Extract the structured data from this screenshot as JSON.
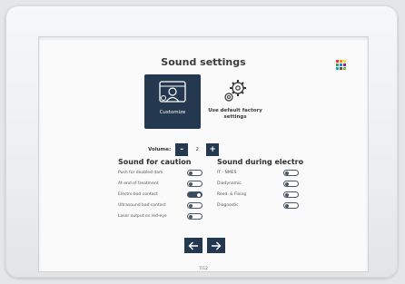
{
  "screen": {
    "title": "Sound settings"
  },
  "modes": {
    "customize_label": "Customize",
    "default_label": "Use default factory settings",
    "selected": "customize"
  },
  "volume": {
    "label": "Volume:",
    "decrease_symbol": "-",
    "value": "2",
    "increase_symbol": "+"
  },
  "caution": {
    "heading": "Sound for caution",
    "items": [
      {
        "label": "Push for doubled dam",
        "enabled": false
      },
      {
        "label": "At end of treatment",
        "enabled": false
      },
      {
        "label": "Electro bad contact",
        "enabled": true
      },
      {
        "label": "Ultrasound bad contact",
        "enabled": false
      },
      {
        "label": "Laser output on led-eye",
        "enabled": false
      }
    ]
  },
  "electro": {
    "heading": "Sound during electro",
    "items": [
      {
        "label": "IT - NMES",
        "enabled": false
      },
      {
        "label": "Diadynamic",
        "enabled": false
      },
      {
        "label": "Reed. & Fixing",
        "enabled": false
      },
      {
        "label": "Diagnostic",
        "enabled": false
      }
    ]
  },
  "navigation": {
    "back_icon": "arrow-left-icon",
    "next_icon": "arrow-right-icon",
    "page_number": "7/12"
  },
  "colors": {
    "accent_dark": "#24394f",
    "toggle_outline": "#4a5866"
  }
}
